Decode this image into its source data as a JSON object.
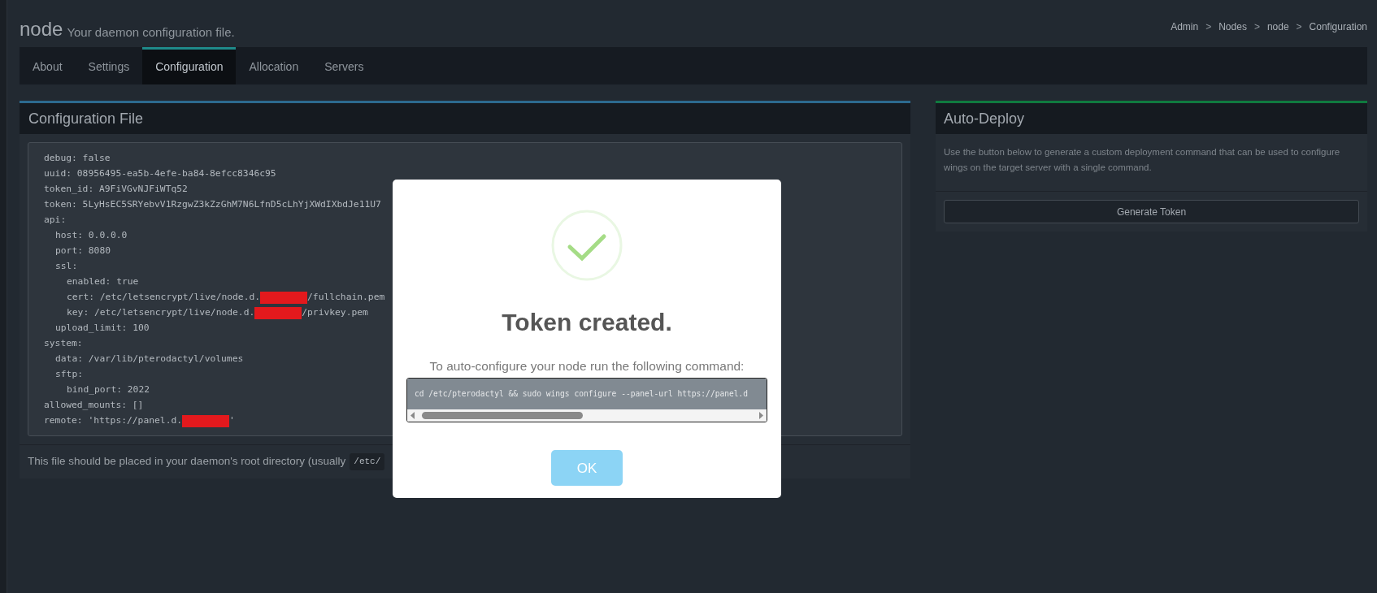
{
  "header": {
    "title": "node",
    "subtitle": "Your daemon configuration file."
  },
  "breadcrumb": [
    {
      "kind": "link",
      "label": "Admin"
    },
    {
      "kind": "separator",
      "label": ">"
    },
    {
      "kind": "link",
      "label": "Nodes"
    },
    {
      "kind": "separator",
      "label": ">"
    },
    {
      "kind": "link",
      "label": "node"
    },
    {
      "kind": "separator",
      "label": ">"
    },
    {
      "kind": "current",
      "label": "Configuration"
    }
  ],
  "tabs": [
    {
      "label": "About",
      "selected": false
    },
    {
      "label": "Settings",
      "selected": false
    },
    {
      "label": "Configuration",
      "selected": true
    },
    {
      "label": "Allocation",
      "selected": false
    },
    {
      "label": "Servers",
      "selected": false
    }
  ],
  "config_panel": {
    "title": "Configuration File",
    "file": [
      {
        "parts": [
          {
            "kind": "text",
            "text": "debug: false"
          }
        ]
      },
      {
        "parts": [
          {
            "kind": "text",
            "text": "uuid: 08956495-ea5b-4efe-ba84-8efcc8346c95"
          }
        ]
      },
      {
        "parts": [
          {
            "kind": "text",
            "text": "token_id: A9FiVGvNJFiWTq52"
          }
        ]
      },
      {
        "parts": [
          {
            "kind": "text",
            "text": "token: 5LyHsEC5SRYebvV1RzgwZ3kZzGhM7N6LfnD5cLhYjXWdIXbdJe11U7"
          }
        ]
      },
      {
        "parts": [
          {
            "kind": "text",
            "text": "api:"
          }
        ],
        "children": [
          {
            "parts": [
              {
                "kind": "text",
                "text": "host: 0.0.0.0"
              }
            ]
          },
          {
            "parts": [
              {
                "kind": "text",
                "text": "port: 8080"
              }
            ]
          },
          {
            "parts": [
              {
                "kind": "text",
                "text": "ssl:"
              }
            ],
            "children": [
              {
                "parts": [
                  {
                    "kind": "text",
                    "text": "enabled: true"
                  }
                ]
              },
              {
                "parts": [
                  {
                    "kind": "text",
                    "text": "cert: /etc/letsencrypt/live/node.d."
                  },
                  {
                    "kind": "redaction"
                  },
                  {
                    "kind": "text",
                    "text": "/fullchain.pem"
                  }
                ]
              },
              {
                "parts": [
                  {
                    "kind": "text",
                    "text": "key: /etc/letsencrypt/live/node.d."
                  },
                  {
                    "kind": "redaction"
                  },
                  {
                    "kind": "text",
                    "text": "/privkey.pem"
                  }
                ]
              }
            ]
          },
          {
            "parts": [
              {
                "kind": "text",
                "text": "upload_limit: 100"
              }
            ]
          }
        ]
      },
      {
        "parts": [
          {
            "kind": "text",
            "text": "system:"
          }
        ],
        "children": [
          {
            "parts": [
              {
                "kind": "text",
                "text": "data: /var/lib/pterodactyl/volumes"
              }
            ]
          },
          {
            "parts": [
              {
                "kind": "text",
                "text": "sftp:"
              }
            ],
            "children": [
              {
                "parts": [
                  {
                    "kind": "text",
                    "text": "bind_port: 2022"
                  }
                ]
              }
            ]
          }
        ]
      },
      {
        "parts": [
          {
            "kind": "text",
            "text": "allowed_mounts: []"
          }
        ]
      },
      {
        "parts": [
          {
            "kind": "text",
            "text": "remote: 'https://panel.d."
          },
          {
            "kind": "redaction"
          },
          {
            "kind": "text",
            "text": "'"
          }
        ]
      }
    ],
    "footer_text": "This file should be placed in your daemon's root directory (usually",
    "footer_code": "/etc/"
  },
  "deploy_panel": {
    "title": "Auto-Deploy",
    "description": "Use the button below to generate a custom deployment command that can be used to configure wings on the target server with a single command.",
    "button": "Generate Token"
  },
  "dialog": {
    "title": "Token created.",
    "message": "To auto-configure your node run the following command:",
    "command": "cd /etc/pterodactyl && sudo wings configure --panel-url https://panel.d",
    "button": "OK"
  }
}
